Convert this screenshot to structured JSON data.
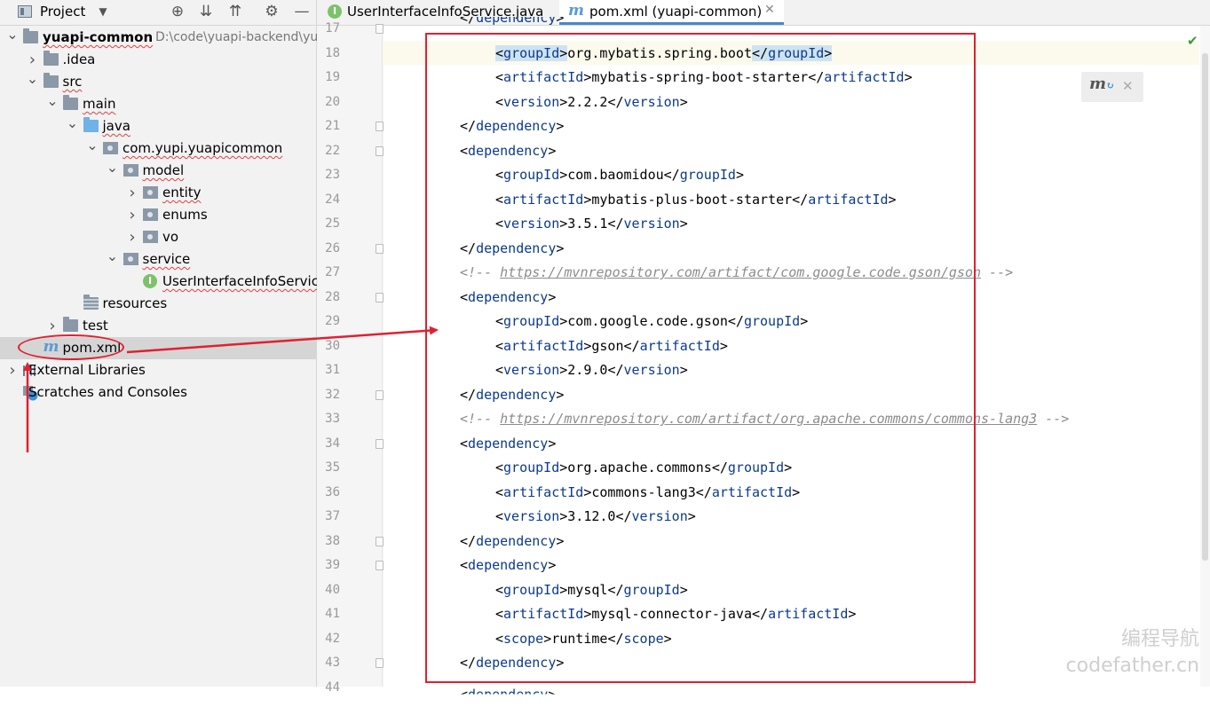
{
  "project_panel": {
    "title": "Project",
    "tree": [
      {
        "label": "yuapi-common",
        "extra": "D:\\code\\yuapi-backend\\yua",
        "icon": "module-folder-icon",
        "depth": 0,
        "arrow": "down"
      },
      {
        "label": ".idea",
        "icon": "folder-icon",
        "depth": 1,
        "arrow": "right"
      },
      {
        "label": "src",
        "icon": "folder-icon",
        "depth": 1,
        "arrow": "down"
      },
      {
        "label": "main",
        "icon": "folder-icon",
        "depth": 2,
        "arrow": "down"
      },
      {
        "label": "java",
        "icon": "source-folder-icon",
        "depth": 3,
        "arrow": "down"
      },
      {
        "label": "com.yupi.yuapicommon",
        "icon": "package-icon",
        "depth": 4,
        "arrow": "down"
      },
      {
        "label": "model",
        "icon": "package-icon",
        "depth": 5,
        "arrow": "down"
      },
      {
        "label": "entity",
        "icon": "package-icon",
        "depth": 6,
        "arrow": "right"
      },
      {
        "label": "enums",
        "icon": "package-icon",
        "depth": 6,
        "arrow": "right"
      },
      {
        "label": "vo",
        "icon": "package-icon",
        "depth": 6,
        "arrow": "right"
      },
      {
        "label": "service",
        "icon": "package-icon",
        "depth": 5,
        "arrow": "down"
      },
      {
        "label": "UserInterfaceInfoService",
        "icon": "interface-icon",
        "depth": 6,
        "arrow": ""
      },
      {
        "label": "resources",
        "icon": "resources-folder-icon",
        "depth": 3,
        "arrow": ""
      },
      {
        "label": "test",
        "icon": "folder-icon",
        "depth": 2,
        "arrow": "right"
      },
      {
        "label": "pom.xml",
        "icon": "maven-icon",
        "depth": 1,
        "arrow": "",
        "selected": true
      },
      {
        "label": "External Libraries",
        "icon": "libraries-icon",
        "depth": 0,
        "arrow": "right"
      },
      {
        "label": "Scratches and Consoles",
        "icon": "scratches-icon",
        "depth": 0,
        "arrow": ""
      }
    ]
  },
  "tabs": [
    {
      "label": "UserInterfaceInfoService.java",
      "icon": "interface-icon",
      "active": false
    },
    {
      "label": "pom.xml (yuapi-common)",
      "icon": "maven-icon",
      "active": true
    }
  ],
  "editor": {
    "lines": [
      {
        "n": "17",
        "indent": 1,
        "kind": "close-partial",
        "tag": "dependency"
      },
      {
        "n": "18",
        "indent": 2,
        "kind": "elem",
        "tag": "groupId",
        "text": "org.mybatis.spring.boot",
        "highlight": true
      },
      {
        "n": "19",
        "indent": 2,
        "kind": "elem",
        "tag": "artifactId",
        "text": "mybatis-spring-boot-starter"
      },
      {
        "n": "20",
        "indent": 2,
        "kind": "elem",
        "tag": "version",
        "text": "2.2.2"
      },
      {
        "n": "21",
        "indent": 1,
        "kind": "close",
        "tag": "dependency"
      },
      {
        "n": "22",
        "indent": 1,
        "kind": "open",
        "tag": "dependency"
      },
      {
        "n": "23",
        "indent": 2,
        "kind": "elem",
        "tag": "groupId",
        "text": "com.baomidou"
      },
      {
        "n": "24",
        "indent": 2,
        "kind": "elem",
        "tag": "artifactId",
        "text": "mybatis-plus-boot-starter"
      },
      {
        "n": "25",
        "indent": 2,
        "kind": "elem",
        "tag": "version",
        "text": "3.5.1"
      },
      {
        "n": "26",
        "indent": 1,
        "kind": "close",
        "tag": "dependency"
      },
      {
        "n": "27",
        "indent": 1,
        "kind": "comment",
        "url": "https://mvnrepository.com/artifact/com.google.code.gson/gson"
      },
      {
        "n": "28",
        "indent": 1,
        "kind": "open",
        "tag": "dependency"
      },
      {
        "n": "29",
        "indent": 2,
        "kind": "elem",
        "tag": "groupId",
        "text": "com.google.code.gson"
      },
      {
        "n": "30",
        "indent": 2,
        "kind": "elem",
        "tag": "artifactId",
        "text": "gson"
      },
      {
        "n": "31",
        "indent": 2,
        "kind": "elem",
        "tag": "version",
        "text": "2.9.0"
      },
      {
        "n": "32",
        "indent": 1,
        "kind": "close",
        "tag": "dependency"
      },
      {
        "n": "33",
        "indent": 1,
        "kind": "comment",
        "url": "https://mvnrepository.com/artifact/org.apache.commons/commons-lang3"
      },
      {
        "n": "34",
        "indent": 1,
        "kind": "open",
        "tag": "dependency"
      },
      {
        "n": "35",
        "indent": 2,
        "kind": "elem",
        "tag": "groupId",
        "text": "org.apache.commons"
      },
      {
        "n": "36",
        "indent": 2,
        "kind": "elem",
        "tag": "artifactId",
        "text": "commons-lang3"
      },
      {
        "n": "37",
        "indent": 2,
        "kind": "elem",
        "tag": "version",
        "text": "3.12.0"
      },
      {
        "n": "38",
        "indent": 1,
        "kind": "close",
        "tag": "dependency"
      },
      {
        "n": "39",
        "indent": 1,
        "kind": "open",
        "tag": "dependency"
      },
      {
        "n": "40",
        "indent": 2,
        "kind": "elem",
        "tag": "groupId",
        "text": "mysql"
      },
      {
        "n": "41",
        "indent": 2,
        "kind": "elem",
        "tag": "artifactId",
        "text": "mysql-connector-java"
      },
      {
        "n": "42",
        "indent": 2,
        "kind": "elem",
        "tag": "scope",
        "text": "runtime"
      },
      {
        "n": "43",
        "indent": 1,
        "kind": "close",
        "tag": "dependency"
      },
      {
        "n": "44",
        "indent": 1,
        "kind": "open-partial",
        "tag": "dependency"
      }
    ]
  },
  "watermark": {
    "line1": "编程导航",
    "line2": "codefather.cn"
  },
  "colors": {
    "annotation_red": "#e02030",
    "xml_tag": "#0c3a8c",
    "accent_tab": "#4a88c7"
  }
}
